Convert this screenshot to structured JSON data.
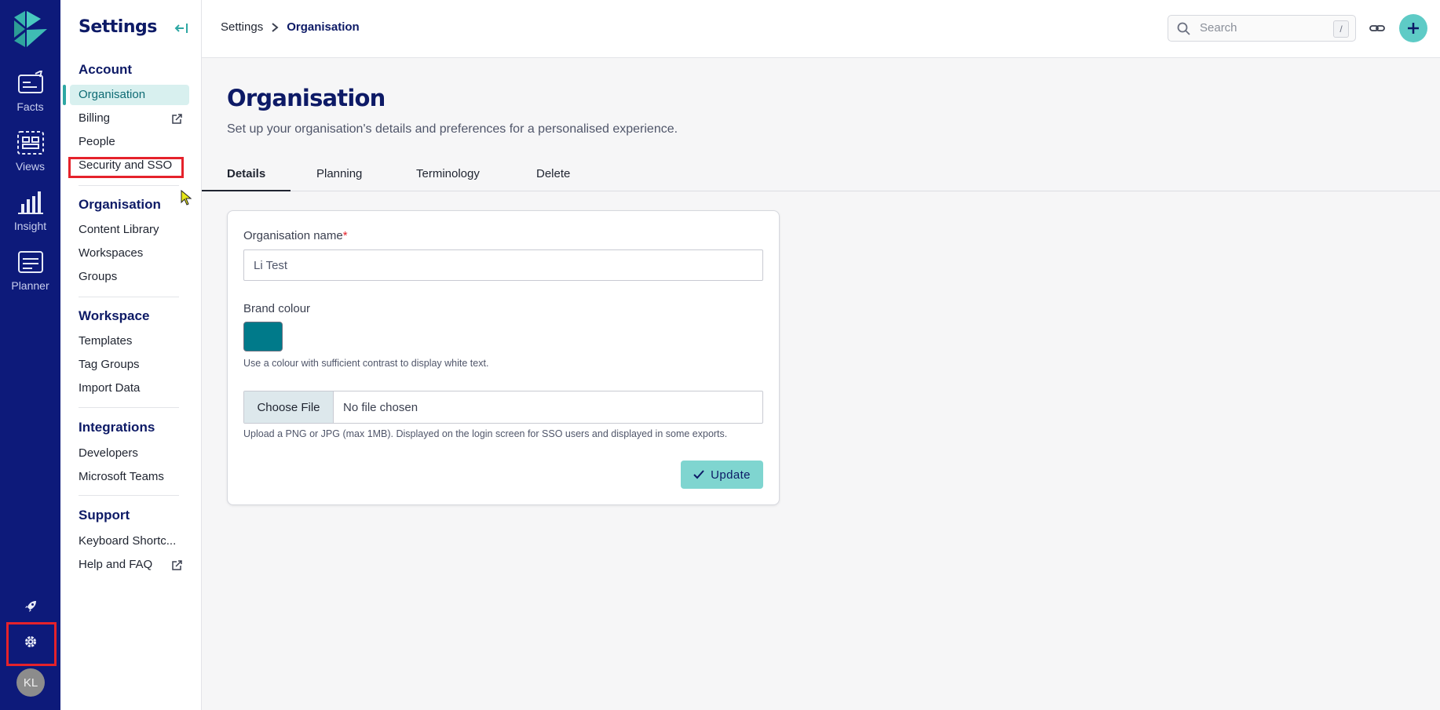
{
  "rail": {
    "items": [
      {
        "label": "Facts",
        "icon": "facts-icon"
      },
      {
        "label": "Views",
        "icon": "views-icon"
      },
      {
        "label": "Insight",
        "icon": "insight-icon"
      },
      {
        "label": "Planner",
        "icon": "planner-icon"
      }
    ],
    "avatar_initials": "KL"
  },
  "sidebar": {
    "title": "Settings",
    "sections": [
      {
        "heading": "Account",
        "items": [
          "Organisation",
          "Billing",
          "People",
          "Security and SSO"
        ]
      },
      {
        "heading": "Organisation",
        "items": [
          "Content Library",
          "Workspaces",
          "Groups"
        ]
      },
      {
        "heading": "Workspace",
        "items": [
          "Templates",
          "Tag Groups",
          "Import Data"
        ]
      },
      {
        "heading": "Integrations",
        "items": [
          "Developers",
          "Microsoft Teams"
        ]
      },
      {
        "heading": "Support",
        "items": [
          "Keyboard Shortc...",
          "Help and FAQ"
        ]
      }
    ],
    "active_item": "Organisation"
  },
  "topbar": {
    "breadcrumb": [
      "Settings",
      "Organisation"
    ],
    "search_placeholder": "Search",
    "search_shortcut": "/"
  },
  "main": {
    "title": "Organisation",
    "subtitle": "Set up your organisation's details and preferences for a personalised experience.",
    "tabs": [
      "Details",
      "Planning",
      "Terminology",
      "Delete"
    ],
    "active_tab": "Details",
    "form": {
      "org_name_label": "Organisation name",
      "org_name_required": "*",
      "org_name_value": "Li Test",
      "brand_label": "Brand colour",
      "brand_color": "#007a8a",
      "brand_hint": "Use a colour with sufficient contrast to display white text.",
      "file_button": "Choose File",
      "file_status": "No file chosen",
      "file_hint": "Upload a PNG or JPG (max 1MB). Displayed on the login screen for SSO users and displayed in some exports.",
      "submit_label": "Update"
    }
  },
  "colors": {
    "rail_bg": "#0d1a7a",
    "accent": "#5ecbc6",
    "highlight_box": "#e5222b"
  }
}
